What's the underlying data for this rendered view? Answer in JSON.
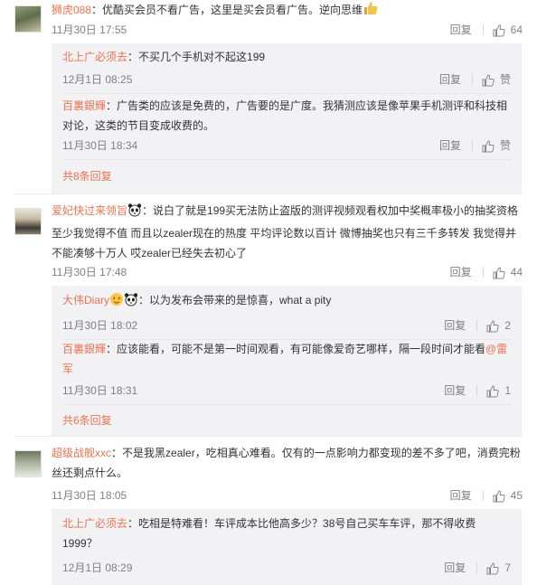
{
  "colors": {
    "username": "#eb7350",
    "meta": "#808080",
    "reply_bg": "#f2f2f5"
  },
  "comments": [
    {
      "user": "狮虎088",
      "text": "：优酷买会员不看广告，这里是买会员看广告。逆向思维",
      "emoji": "thumbs-up-emoji",
      "time": "11月30日 17:55",
      "reply_label": "回复",
      "likes": "64",
      "replies": [
        {
          "user": "北上广必须去",
          "text": "：不买几个手机对不起这199",
          "time": "12月1日 08:25",
          "reply_label": "回复",
          "likes": "赞"
        },
        {
          "user": "百裏銀輝",
          "text": "：广告类的应该是免费的，广告要的是广度。我猜测应该是像苹果手机测评和科技相对论，这类的节目变成收费的。",
          "time": "11月30日 18:34",
          "reply_label": "回复",
          "likes": "赞"
        }
      ],
      "more": "共8条回复"
    },
    {
      "user": "爱妃快过来领旨",
      "text": "：说白了就是199买无法防止盗版的测评视频观看权加中奖概率极小的抽奖资格至少我觉得不值  而且以zealer现在的热度 平均评论数以百计 微博抽奖也只有三千多转发 我觉得并不能凑够十万人 哎zealer已经失去初心了",
      "time": "11月30日 17:48",
      "reply_label": "回复",
      "likes": "44",
      "replies": [
        {
          "user": "大伟Diary",
          "text": "：以为发布会带来的是惊喜，what a pity",
          "time": "11月30日 18:02",
          "reply_label": "回复",
          "likes": "2"
        },
        {
          "user": "百裏銀輝",
          "text": "：应该能看，可能不是第一时间观看，有可能像爱奇艺哪样，隔一段时间才能看",
          "mention": "@雷军",
          "time": "11月30日 18:31",
          "reply_label": "回复",
          "likes": "1"
        }
      ],
      "more": "共6条回复"
    },
    {
      "user": "超级战舰xxc",
      "text": "：不是我黑zealer，吃相真心难看。仅有的一点影响力都变现的差不多了吧，消费完粉丝还剩点什么。",
      "time": "11月30日 18:05",
      "reply_label": "回复",
      "likes": "45",
      "replies": [
        {
          "user": "北上广必须去",
          "text": "：吃相是特难看！车评成本比他高多少？38号自己买车车评，那不得收费1999？",
          "time": "12月1日 08:29",
          "reply_label": "回复",
          "likes": "7"
        }
      ]
    }
  ]
}
